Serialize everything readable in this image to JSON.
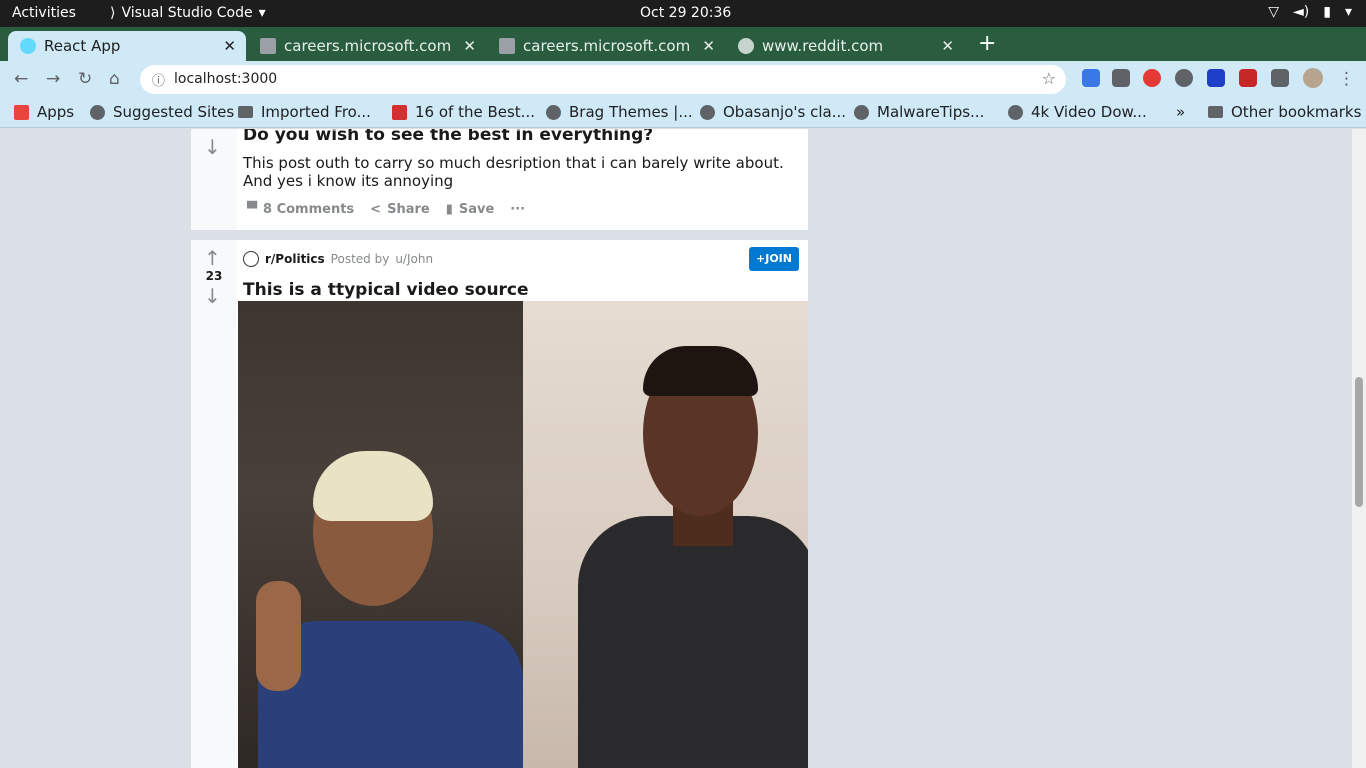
{
  "system_bar": {
    "activities": "Activities",
    "app_name": "Visual Studio Code",
    "clock": "Oct 29  20:36"
  },
  "tabs": [
    {
      "title": "React App",
      "favicon": "react-icon",
      "active": true
    },
    {
      "title": "careers.microsoft.com",
      "favicon": "microsoft-icon",
      "active": false
    },
    {
      "title": "careers.microsoft.com",
      "favicon": "microsoft-icon",
      "active": false
    },
    {
      "title": "www.reddit.com",
      "favicon": "reddit-icon",
      "active": false
    }
  ],
  "tab_close": "✕",
  "new_tab": "+",
  "address_bar": {
    "url": "localhost:3000"
  },
  "bookmarks": {
    "items": [
      "Apps",
      "Suggested Sites",
      "Imported Fro...",
      "16 of the Best...",
      "Brag Themes |...",
      "Obasanjo's cla...",
      "MalwareTips...",
      "4k Video Dow..."
    ],
    "overflow": "»",
    "other": "Other bookmarks"
  },
  "post1": {
    "title": "Do you wish to see the best in everything?",
    "description": "This post outh to carry so much desription that i can barely write about. And yes i know its annoying",
    "comments": "8 Comments",
    "share": "Share",
    "save": "Save",
    "more": "···"
  },
  "post2": {
    "votes": "23",
    "subreddit": "r/Politics",
    "posted_by": "Posted by",
    "user": "u/John",
    "join": "+JOIN",
    "title": "This is a ttypical video source"
  },
  "colors": {
    "join_button": "#0079d3",
    "tab_strip": "#2a5d40",
    "toolbar": "#cfe9f6",
    "page_bg": "#dae0e6"
  }
}
